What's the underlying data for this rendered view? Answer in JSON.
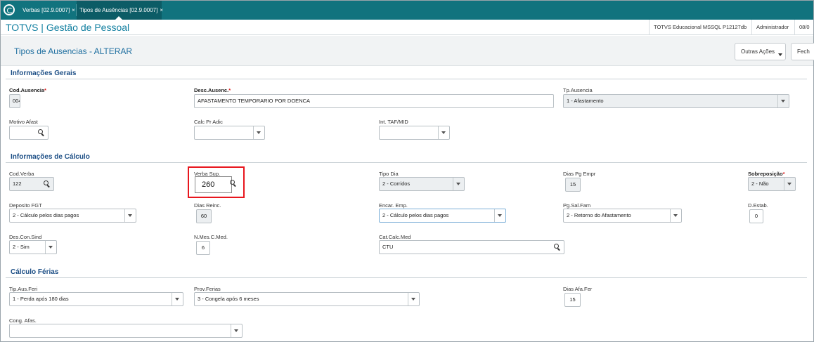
{
  "tabs": [
    {
      "label": "Verbas [02.9.0007]",
      "close": "×"
    },
    {
      "label": "Tipos de Ausências [02.9.0007]",
      "close": "×"
    }
  ],
  "header": {
    "app_title": "TOTVS | Gestão de Pessoal",
    "environment": "TOTVS Educacional MSSQL P12127db",
    "user": "Administrador",
    "date": "08/0"
  },
  "page": {
    "title": "Tipos de Ausencias - ALTERAR",
    "more_actions": "Outras Ações",
    "close_button": "Fech"
  },
  "sections": {
    "general": "Informações Gerais",
    "calc": "Informações de Cálculo",
    "vacation": "Cálculo Férias"
  },
  "fields": {
    "cod_ausencia": {
      "label": "Cod.Ausencia",
      "value": "004"
    },
    "desc_ausenc": {
      "label": "Desc.Ausenc.",
      "value": "AFASTAMENTO TEMPORARIO POR DOENCA"
    },
    "tp_ausencia": {
      "label": "Tp.Ausencia",
      "value": "1 - Afastamento"
    },
    "motivo_afast": {
      "label": "Motivo Afast",
      "value": ""
    },
    "calc_pr_adic": {
      "label": "Calc Pr Adic",
      "value": ""
    },
    "int_taf": {
      "label": "Int. TAF/MID",
      "value": ""
    },
    "cod_verba": {
      "label": "Cod.Verba",
      "value": "122"
    },
    "verba_sup": {
      "label": "Verba Sup.",
      "value": "260"
    },
    "tipo_dia": {
      "label": "Tipo Dia",
      "value": "2 - Corridos"
    },
    "dias_pg_empr": {
      "label": "Dias Pg Empr",
      "value": "15"
    },
    "sobreposicao": {
      "label": "Sobreposição",
      "value": "2 - Não"
    },
    "deposito_fgt": {
      "label": "Deposito FGT",
      "value": "2 - Cálculo pelos dias pagos"
    },
    "dias_reinc": {
      "label": "Dias Reinc.",
      "value": "60"
    },
    "encar_emp": {
      "label": "Encar. Emp.",
      "value": "2 - Cálculo pelos dias pagos"
    },
    "pg_sal_fam": {
      "label": "Pg.Sal.Fam",
      "value": "2 - Retorno do Afastamento"
    },
    "d_estab": {
      "label": "D.Estab.",
      "value": "0"
    },
    "des_con_sind": {
      "label": "Des.Con.Sind",
      "value": "2 - Sim"
    },
    "n_mes_c_med": {
      "label": "N.Mes.C.Med.",
      "value": "6"
    },
    "cat_calc_med": {
      "label": "Cat.Calc.Med",
      "value": "CTU"
    },
    "tip_aus_feri": {
      "label": "Tip.Aus.Feri",
      "value": "1 - Perda após 180 dias"
    },
    "prov_ferias": {
      "label": "Prov.Ferias",
      "value": "3 - Congela após 6 meses"
    },
    "dias_afa_fer": {
      "label": "Dias Afa.Fer",
      "value": "15"
    },
    "cong_afas": {
      "label": "Cong. Afas.",
      "value": ""
    }
  },
  "required_mark": "*",
  "colors": {
    "tabbar": "#11737e",
    "title": "#117fa0",
    "section": "#1d4f86",
    "highlight": "#e8161d"
  }
}
